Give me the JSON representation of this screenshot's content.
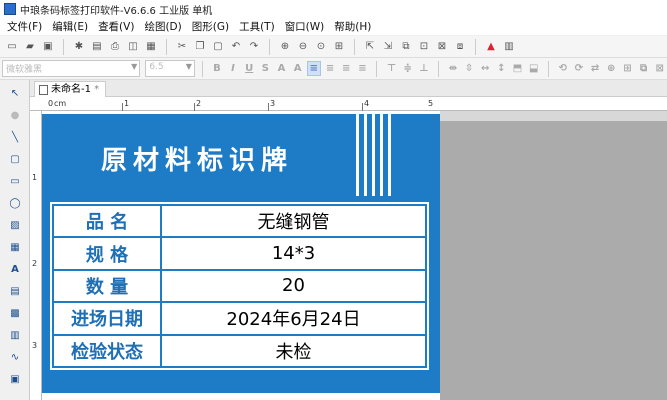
{
  "window": {
    "title": "中琅条码标签打印软件-V6.6.6 工业版 单机"
  },
  "menu": [
    "文件(F)",
    "编辑(E)",
    "查看(V)",
    "绘图(D)",
    "图形(G)",
    "工具(T)",
    "窗口(W)",
    "帮助(H)"
  ],
  "format_bar": {
    "font_placeholder": "微软雅黑",
    "font_size": "6.5"
  },
  "document_tab": {
    "name": "未命名-1",
    "modified": "*"
  },
  "ruler": {
    "unit": "cm",
    "h_labels": [
      "0",
      "1",
      "2",
      "3",
      "4",
      "5"
    ],
    "v_labels": [
      "1",
      "2",
      "3"
    ]
  },
  "label": {
    "title": "原材料标识牌",
    "rows": [
      {
        "key": "品  名",
        "value": "无缝钢管"
      },
      {
        "key": "规  格",
        "value": "14*3"
      },
      {
        "key": "数  量",
        "value": "20"
      },
      {
        "key": "进场日期",
        "value": "2024年6月24日"
      },
      {
        "key": "检验状态",
        "value": "未检"
      }
    ]
  },
  "colors": {
    "label_blue": "#1e7cc7",
    "key_text": "#1e6fb5",
    "canvas_bg": "#ababab"
  }
}
